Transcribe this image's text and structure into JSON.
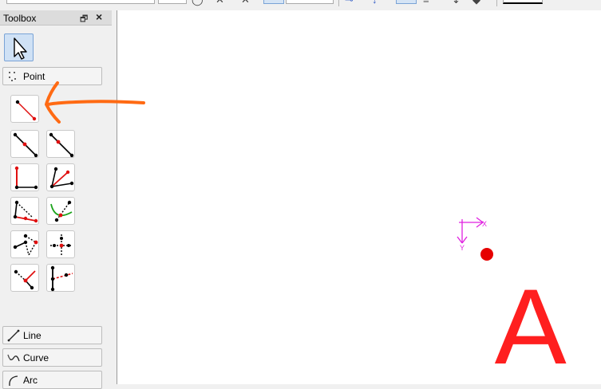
{
  "toolbox": {
    "title": "Toolbox",
    "float_icon": "restore-icon",
    "close_icon": "close-icon",
    "selector_tool": "pointer-arrow-icon",
    "groups": {
      "point": "Point",
      "line": "Line",
      "curve": "Curve",
      "arc": "Arc"
    },
    "tools": [
      "line-segment-tool-icon",
      "line-through-point-icon",
      "line-ray-icon",
      "perpendicular-angle-icon",
      "angle-bisector-icon",
      "triangle-dashed-icon",
      "curve-intersection-icon",
      "spline-dashed-icon",
      "axis-cross-icon",
      "point-on-line-icon",
      "perpendicular-dashed-icon"
    ]
  },
  "canvas": {
    "axis_x_label": "X",
    "axis_y_label": "Y",
    "big_letter": "A",
    "colors": {
      "annotation_arrow": "#ff6a13",
      "axis": "#e020e0",
      "point": "#e60000",
      "letter": "#ff1f1f"
    }
  }
}
